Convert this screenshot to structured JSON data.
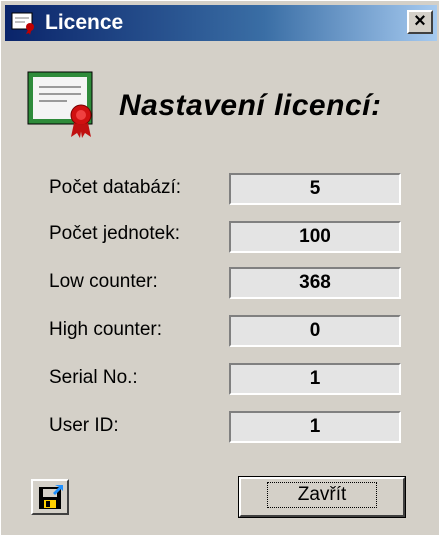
{
  "window": {
    "title": "Licence",
    "close_glyph": "×"
  },
  "header": {
    "title": "Nastavení licencí:"
  },
  "fields": [
    {
      "label": "Počet databází:",
      "value": "5"
    },
    {
      "label": "Počet jednotek:",
      "value": "100"
    },
    {
      "label": "Low counter:",
      "value": "368"
    },
    {
      "label": "High counter:",
      "value": "0"
    },
    {
      "label": "Serial No.:",
      "value": "1"
    },
    {
      "label": "User ID:",
      "value": "1"
    }
  ],
  "buttons": {
    "close_label": "Zavřít",
    "save_icon": "floppy-disk-icon"
  },
  "colors": {
    "window_bg": "#d4d0c8",
    "title_bar_start": "#0a246a",
    "title_bar_end": "#a6caf0",
    "field_bg": "#e4e4e4"
  }
}
